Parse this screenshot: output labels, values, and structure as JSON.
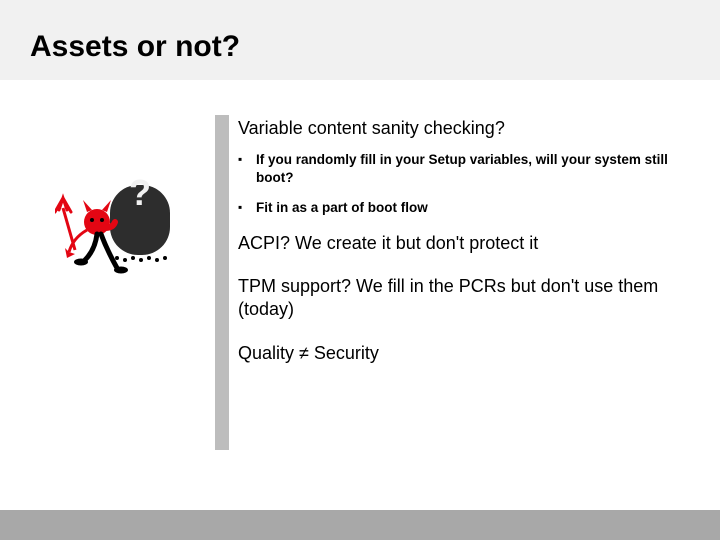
{
  "title": "Assets or not?",
  "heading1": "Variable content sanity checking?",
  "bullets": [
    "If you randomly fill in your Setup variables, will your system still boot?",
    "Fit in as a part of boot flow"
  ],
  "para_acpi": "ACPI? We create it but don't protect it",
  "para_tpm": "TPM support? We fill in the PCRs but don't use them (today)",
  "para_quality": "Quality  ≠ Security",
  "question_mark": "?"
}
